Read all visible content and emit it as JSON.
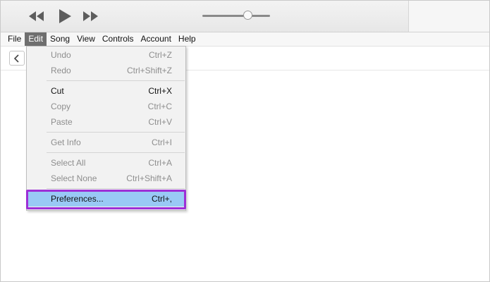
{
  "player": {
    "icons": [
      "rewind-icon",
      "play-icon",
      "fast-forward-icon"
    ],
    "volume_level": 0.67
  },
  "menu_bar": {
    "items": [
      "File",
      "Edit",
      "Song",
      "View",
      "Controls",
      "Account",
      "Help"
    ],
    "active": "Edit"
  },
  "edit_menu": {
    "items": [
      {
        "label": "Undo",
        "shortcut": "Ctrl+Z",
        "enabled": false
      },
      {
        "label": "Redo",
        "shortcut": "Ctrl+Shift+Z",
        "enabled": false
      },
      {
        "label": "Cut",
        "shortcut": "Ctrl+X",
        "enabled": true
      },
      {
        "label": "Copy",
        "shortcut": "Ctrl+C",
        "enabled": false
      },
      {
        "label": "Paste",
        "shortcut": "Ctrl+V",
        "enabled": false
      },
      {
        "label": "Get Info",
        "shortcut": "Ctrl+I",
        "enabled": false
      },
      {
        "label": "Select All",
        "shortcut": "Ctrl+A",
        "enabled": false
      },
      {
        "label": "Select None",
        "shortcut": "Ctrl+Shift+A",
        "enabled": false
      },
      {
        "label": "Preferences...",
        "shortcut": "Ctrl+,",
        "enabled": true,
        "highlighted": true
      }
    ]
  },
  "colors": {
    "highlight": "#99c9f5",
    "annotation_frame": "#9d2fd6",
    "active_menu": "#6f6f6f"
  }
}
